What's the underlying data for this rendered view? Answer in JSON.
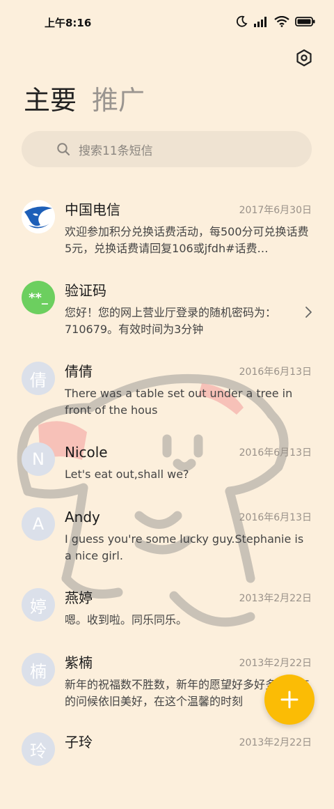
{
  "status": {
    "time": "上午8:16",
    "battery": "battery-icon"
  },
  "tabs": [
    {
      "label": "主要"
    },
    {
      "label": "推广"
    }
  ],
  "search": {
    "placeholder": "搜索11条短信"
  },
  "conversations": [
    {
      "name": "中国电信",
      "date": "2017年6月30日",
      "preview": "欢迎参加积分兑换话费活动，每500分可兑换话费5元，兑换话费请回复106或jfdh#话费…",
      "avatar": "telecom-logo"
    },
    {
      "name": "验证码",
      "date": "",
      "preview": "您好！您的网上营业厅登录的随机密码为：710679。有效时间为3分钟",
      "avatar_text": "**_"
    },
    {
      "name": "倩倩",
      "date": "2016年6月13日",
      "preview": "There was a table set out under a tree in front of the hous",
      "avatar_text": "倩"
    },
    {
      "name": "Nicole",
      "date": "2016年6月13日",
      "preview": "Let's eat out,shall we?",
      "avatar_text": "N"
    },
    {
      "name": "Andy",
      "date": "2016年6月13日",
      "preview": "I guess you're some lucky guy.Stephanie is a nice girl.",
      "avatar_text": "A"
    },
    {
      "name": "燕婷",
      "date": "2013年2月22日",
      "preview": "嗯。收到啦。同乐同乐。",
      "avatar_text": "婷"
    },
    {
      "name": "紫楠",
      "date": "2013年2月22日",
      "preview": "新年的祝福数不胜数，新年的愿望好多好多，新年的问候依旧美好，在这个温馨的时刻",
      "avatar_text": "楠"
    },
    {
      "name": "子玲",
      "date": "2013年2月22日",
      "preview": "",
      "avatar_text": "玲"
    }
  ],
  "colors": {
    "background": "#fcefdc",
    "fab": "#fbbc05",
    "verify_avatar": "#6ccf5f",
    "telecom_blue": "#1d5fb8"
  }
}
